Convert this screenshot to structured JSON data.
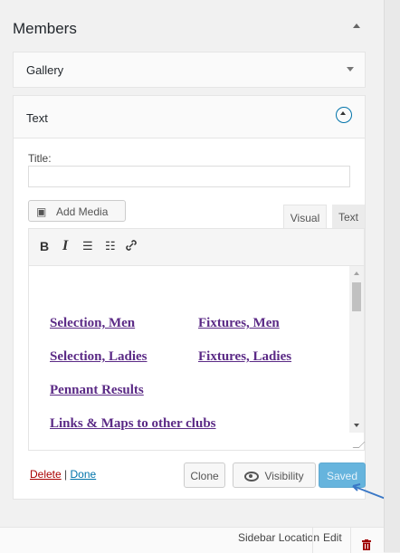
{
  "members": {
    "title": "Members"
  },
  "gallery": {
    "label": "Gallery"
  },
  "text_widget": {
    "label": "Text",
    "title_label": "Title:",
    "title_value": "",
    "add_media": "Add Media",
    "tabs": {
      "visual": "Visual",
      "text": "Text"
    },
    "toolbar": {
      "bold": "B",
      "italic": "I",
      "ul": "☰",
      "ol": "☷",
      "link": "🔗"
    },
    "links": [
      "Selection, Men",
      "Fixtures, Men",
      "Selection, Ladies",
      "Fixtures, Ladies",
      "Pennant Results",
      "Links & Maps to other clubs"
    ],
    "actions": {
      "delete": "Delete",
      "separator": "|",
      "done": "Done"
    },
    "buttons": {
      "clone": "Clone",
      "visibility": "Visibility",
      "saved": "Saved"
    }
  },
  "bottom_bar": {
    "sidebar_location": "Sidebar Location",
    "edit": "Edit"
  },
  "icons": {
    "trash": "trash-icon",
    "eye": "eye-icon",
    "media": "media-icon"
  },
  "colors": {
    "accent": "#0073aa",
    "link": "#5b2a86",
    "delete": "#a00000",
    "saved": "#66b4dd",
    "trash": "#a00000"
  }
}
